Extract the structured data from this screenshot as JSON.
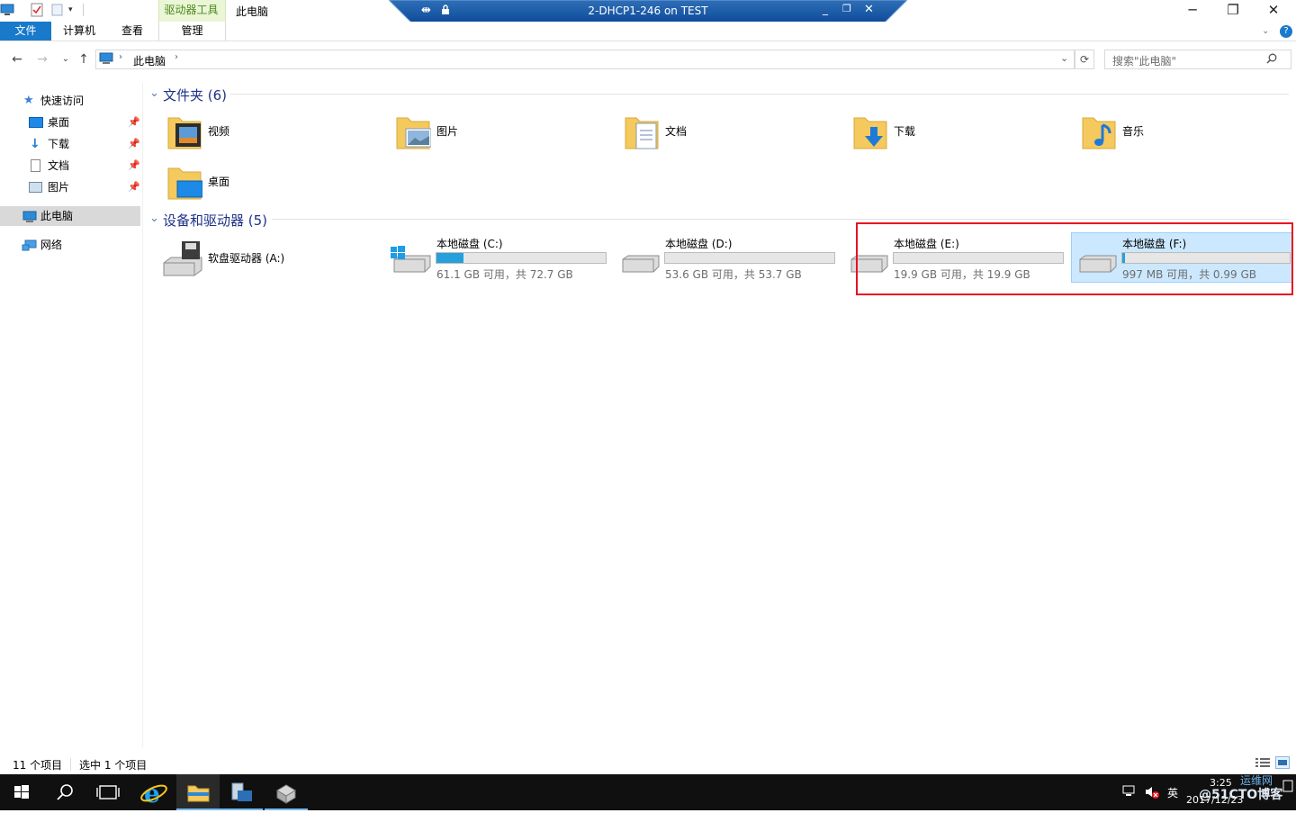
{
  "ribbon": {
    "context_group_label": "驱动器工具",
    "window_title": "此电脑",
    "tabs": {
      "file": "文件",
      "computer": "计算机",
      "view": "查看",
      "manage": "管理"
    }
  },
  "remote_bar": {
    "title": "2-DHCP1-246 on TEST"
  },
  "address": {
    "breadcrumb": "此电脑",
    "search_placeholder": "搜索\"此电脑\""
  },
  "nav_pane": {
    "quick_access": "快速访问",
    "items": [
      {
        "label": "桌面",
        "icon": "desktop-icon"
      },
      {
        "label": "下载",
        "icon": "download-icon"
      },
      {
        "label": "文档",
        "icon": "document-icon"
      },
      {
        "label": "图片",
        "icon": "picture-icon"
      }
    ],
    "this_pc": "此电脑",
    "network": "网络"
  },
  "folders": {
    "header": "文件夹 (6)",
    "items": [
      {
        "label": "视频",
        "icon": "video-folder-icon"
      },
      {
        "label": "图片",
        "icon": "pictures-folder-icon"
      },
      {
        "label": "文档",
        "icon": "documents-folder-icon"
      },
      {
        "label": "下载",
        "icon": "downloads-folder-icon"
      },
      {
        "label": "音乐",
        "icon": "music-folder-icon"
      },
      {
        "label": "桌面",
        "icon": "desktop-folder-icon"
      }
    ]
  },
  "drives": {
    "header": "设备和驱动器 (5)",
    "floppy": {
      "label": "软盘驱动器 (A:)"
    },
    "items": [
      {
        "name": "本地磁盘 (C:)",
        "info": "61.1 GB 可用，共 72.7 GB",
        "used_fraction": 0.16
      },
      {
        "name": "本地磁盘 (D:)",
        "info": "53.6 GB 可用，共 53.7 GB",
        "used_fraction": 0.0
      },
      {
        "name": "本地磁盘 (E:)",
        "info": "19.9 GB 可用，共 19.9 GB",
        "used_fraction": 0.0
      },
      {
        "name": "本地磁盘 (F:)",
        "info": "997 MB 可用，共 0.99 GB",
        "used_fraction": 0.015
      }
    ]
  },
  "status": {
    "count": "11 个项目",
    "selected": "选中 1 个项目"
  },
  "taskbar": {
    "ime": "英",
    "time": "3:25",
    "date": "2017/12/23",
    "watermark": "@51CTO博客",
    "watermark_top": "运维网"
  },
  "colors": {
    "accent": "#1979ca",
    "selection": "#cce8ff",
    "highlight_box": "#e81123",
    "bar_fill": "#26a0da"
  }
}
